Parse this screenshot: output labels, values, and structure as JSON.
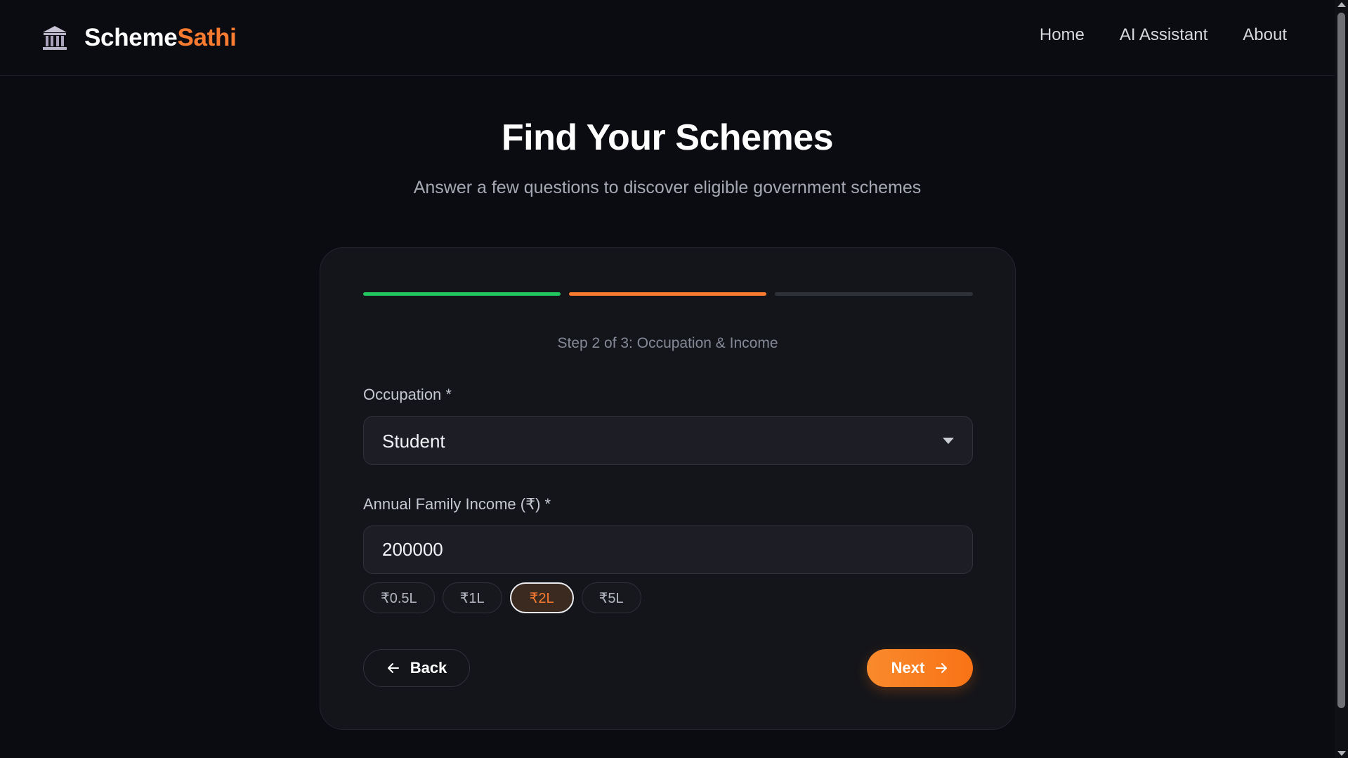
{
  "brand": {
    "name_part1": "Scheme",
    "name_part2": "Sathi",
    "icon": "government-building-icon"
  },
  "nav": {
    "items": [
      {
        "label": "Home"
      },
      {
        "label": "AI Assistant"
      },
      {
        "label": "About"
      }
    ]
  },
  "hero": {
    "title": "Find Your Schemes",
    "subtitle": "Answer a few questions to discover eligible government schemes"
  },
  "wizard": {
    "step_label": "Step 2 of 3: Occupation & Income",
    "progress": {
      "total_steps": 3,
      "completed": 1,
      "current": 2
    },
    "occupation": {
      "label": "Occupation *",
      "value": "Student"
    },
    "income": {
      "label": "Annual Family Income (₹) *",
      "value": "200000",
      "presets": [
        {
          "label": "₹0.5L"
        },
        {
          "label": "₹1L"
        },
        {
          "label": "₹2L"
        },
        {
          "label": "₹5L"
        }
      ],
      "selected_preset": "₹2L"
    },
    "back_label": "Back",
    "next_label": "Next"
  },
  "colors": {
    "accent": "#f97b30",
    "success": "#22c55e",
    "background": "#0b0c12",
    "card": "#14151a"
  }
}
